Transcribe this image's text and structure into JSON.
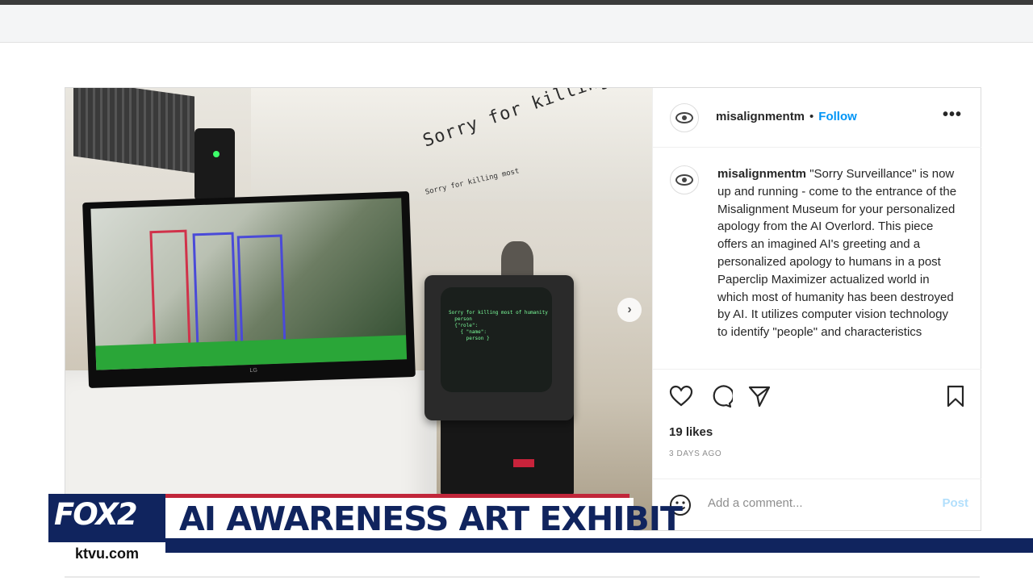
{
  "post": {
    "username": "misalignmentm",
    "follow_label": "Follow",
    "separator": "•",
    "more_label": "•••",
    "caption_text": "\"Sorry Surveillance\" is now up and running - come to the entrance of the Misalignment Museum for your personalized apology from the AI Overlord. This piece offers an imagined AI's greeting and a personalized apology to humans in a post Paperclip Maximizer actualized world in which most of humanity has been destroyed by AI. It utilizes computer vision technology to identify \"people\" and characteristics",
    "likes": "19 likes",
    "time_ago": "3 DAYS AGO",
    "comment_placeholder": "Add a comment...",
    "post_button": "Post",
    "next_arrow": "›"
  },
  "photo": {
    "wall_text": "Sorry for killing most of humanity",
    "wall_text_small": "Sorry for killing most",
    "monitor_brand": "LG",
    "crt_text": "Sorry for killing most of humanity\n  person\n  {\"role\":\n    { \"name\":\n      person }"
  },
  "broadcast": {
    "logo": "FOX2",
    "site": "ktvu.com",
    "headline": "AI AWARENESS ART EXHIBIT"
  },
  "colors": {
    "follow": "#0095f6",
    "navy": "#10245e",
    "red": "#c1263a"
  },
  "icons": [
    "heart-icon",
    "comment-icon",
    "share-icon",
    "bookmark-icon",
    "emoji-icon",
    "more-icon",
    "chevron-right-icon"
  ]
}
